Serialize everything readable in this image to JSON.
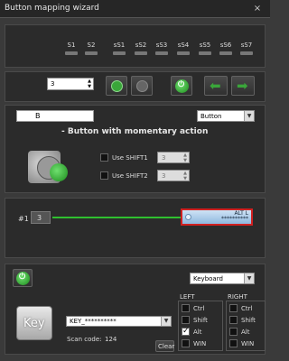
{
  "window": {
    "title": "Button mapping wizard",
    "close": "×"
  },
  "status": {
    "labels": [
      "S1",
      "S2",
      "sS1",
      "sS2",
      "sS3",
      "sS4",
      "sS5",
      "sS6",
      "sS7"
    ],
    "led_color": "#777777"
  },
  "toolbar": {
    "button_number": "3",
    "icons": [
      "copy-icon",
      "paste-icon",
      "reset-icon",
      "arrow-left-icon",
      "arrow-right-icon"
    ],
    "accent": "#3aa63a"
  },
  "button_config": {
    "name_value": "B",
    "type_select": "Button",
    "description": "- Button with momentary action",
    "shift1_label": "Use SHIFT1",
    "shift1_value": "3",
    "shift2_label": "Use SHIFT2",
    "shift2_value": "3"
  },
  "timeline": {
    "row_label": "#1",
    "row_value": "3",
    "event_label": "ALT L",
    "event_sub": "**********",
    "line_color": "#2fbf2f",
    "highlight_color": "#d02020"
  },
  "output": {
    "mode_select": "Keyboard",
    "key_label": "Key",
    "key_select": "KEY_**********",
    "scan_code_label": "Scan code:",
    "scan_code_value": "124",
    "clear_label": "Clear",
    "left_header": "LEFT",
    "right_header": "RIGHT",
    "modifiers": [
      "Ctrl",
      "Shift",
      "Alt",
      "WIN"
    ],
    "left_checked": "Alt",
    "check_mark": "✓"
  }
}
